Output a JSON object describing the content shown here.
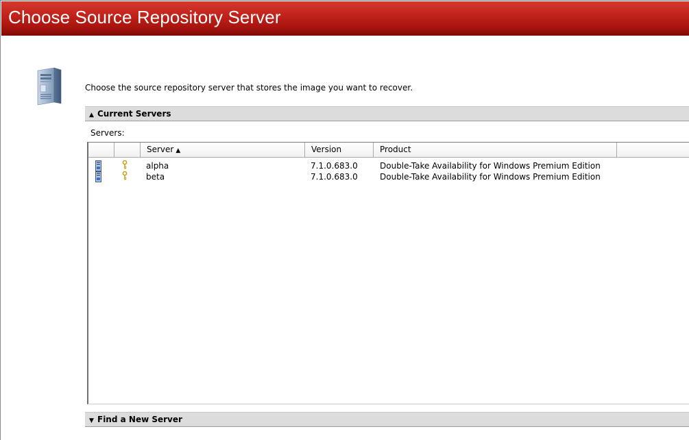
{
  "window": {
    "title": "Choose Source Repository Server"
  },
  "instruction": "Choose the source repository server that stores the image you want to recover.",
  "current_servers": {
    "header": "Current Servers",
    "arrow": "▲",
    "servers_label": "Servers:",
    "columns": [
      {
        "label": ""
      },
      {
        "label": ""
      },
      {
        "label": "Server",
        "sort": "▲"
      },
      {
        "label": "Version"
      },
      {
        "label": "Product"
      },
      {
        "label": ""
      }
    ],
    "rows": [
      {
        "icon": "server-icon",
        "key_icon": "key-icon",
        "server": "alpha",
        "version": "7.1.0.683.0",
        "product": "Double-Take Availability for Windows Premium Edition"
      },
      {
        "icon": "server-icon",
        "key_icon": "key-icon",
        "server": "beta",
        "version": "7.1.0.683.0",
        "product": "Double-Take Availability for Windows Premium Edition"
      }
    ]
  },
  "find_new_server": {
    "header": "Find a New Server",
    "arrow": "▼"
  },
  "colors": {
    "title_bar_top": "#d63a2e",
    "title_bar_bottom": "#7d0a08",
    "section_header_bg": "#dcdcdc"
  }
}
